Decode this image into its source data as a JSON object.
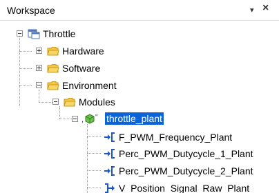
{
  "panel": {
    "title": "Workspace",
    "pin_glyph": "▾",
    "close_glyph": "×"
  },
  "tree": {
    "root": {
      "label": "Throttle",
      "icon": "workspace-icon",
      "expanded": true
    },
    "folders": [
      {
        "label": "Hardware",
        "expanded": false
      },
      {
        "label": "Software",
        "expanded": false
      },
      {
        "label": "Environment",
        "expanded": true
      }
    ],
    "modules_folder": {
      "label": "Modules",
      "expanded": true
    },
    "selected_item": {
      "label": "throttle_plant",
      "icon": "plant-model-icon",
      "expanded": true
    },
    "ports": [
      {
        "label": "F_PWM_Frequency_Plant",
        "direction": "input"
      },
      {
        "label": "Perc_PWM_Dutycycle_1_Plant",
        "direction": "input"
      },
      {
        "label": "Perc_PWM_Dutycycle_2_Plant",
        "direction": "input"
      },
      {
        "label": "V_Position_Signal_Raw_Plant",
        "direction": "output"
      }
    ]
  },
  "colors": {
    "selection": "#0a64d8",
    "folder": "#f2c744",
    "port_arrow": "#1a55c9"
  }
}
